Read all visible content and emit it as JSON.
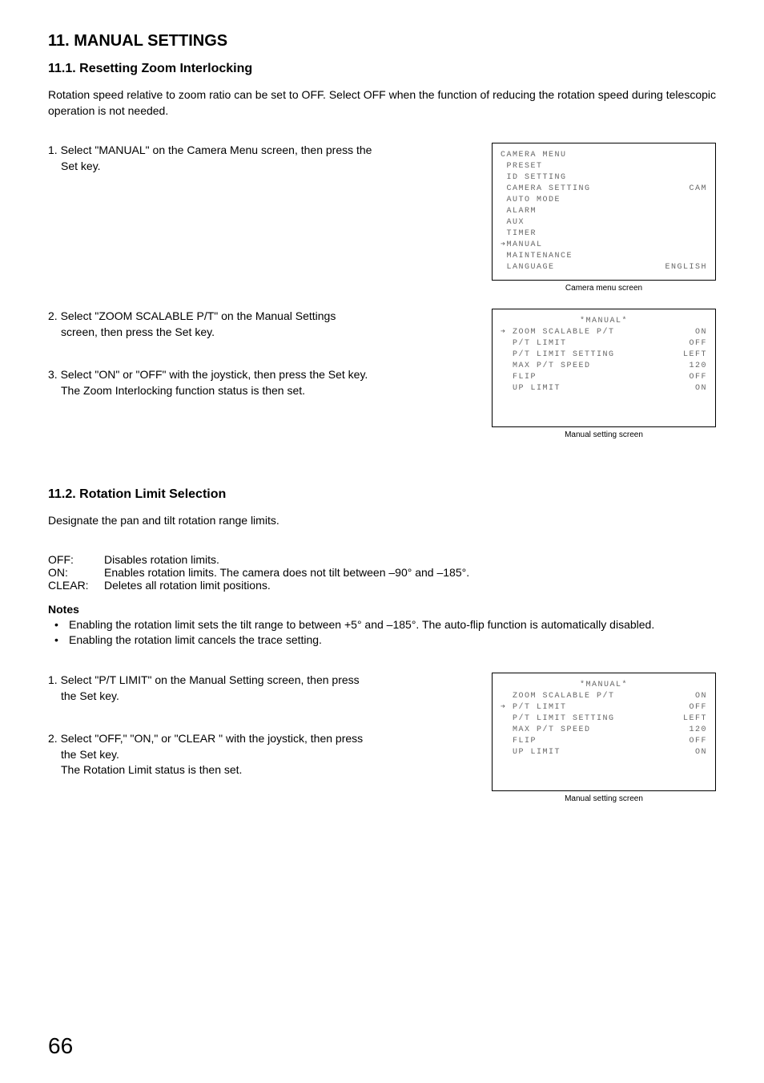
{
  "section": {
    "title": "11. MANUAL SETTINGS"
  },
  "sub1": {
    "title": "11.1. Resetting Zoom Interlocking",
    "intro": "Rotation speed relative to zoom ratio can be set to OFF. Select OFF when the function of reducing the rotation speed during telescopic operation is not needed.",
    "step1a": "1. Select \"MANUAL\" on the Camera Menu screen, then press the",
    "step1b": "Set key.",
    "step2a": "2. Select \"ZOOM SCALABLE P/T\" on the Manual Settings",
    "step2b": "screen, then press the Set key.",
    "step3a": "3. Select \"ON\" or \"OFF\" with the joystick, then press the Set key.",
    "step3b": "The Zoom Interlocking function status is then set."
  },
  "osd_camera_menu": {
    "title": "CAMERA MENU",
    "items": [
      {
        "label": " PRESET",
        "value": ""
      },
      {
        "label": " ID SETTING",
        "value": ""
      },
      {
        "label": " CAMERA SETTING",
        "value": "CAM"
      },
      {
        "label": " AUTO MODE",
        "value": ""
      },
      {
        "label": " ALARM",
        "value": ""
      },
      {
        "label": " AUX",
        "value": ""
      },
      {
        "label": " TIMER",
        "value": ""
      },
      {
        "label": "➔MANUAL",
        "value": ""
      },
      {
        "label": " MAINTENANCE",
        "value": ""
      },
      {
        "label": " LANGUAGE",
        "value": "ENGLISH"
      }
    ],
    "caption": "Camera menu screen"
  },
  "osd_manual_1": {
    "title": "*MANUAL*",
    "items": [
      {
        "label": "➔ ZOOM SCALABLE P/T",
        "value": "ON"
      },
      {
        "label": "  P/T LIMIT",
        "value": "OFF"
      },
      {
        "label": "  P/T LIMIT SETTING",
        "value": "LEFT"
      },
      {
        "label": "  MAX P/T SPEED",
        "value": "120"
      },
      {
        "label": "  FLIP",
        "value": "OFF"
      },
      {
        "label": "  UP LIMIT",
        "value": "ON"
      }
    ],
    "caption": "Manual setting screen"
  },
  "sub2": {
    "title": "11.2. Rotation Limit Selection",
    "intro": "Designate the pan and tilt rotation range limits.",
    "defs": [
      {
        "label": "OFF:",
        "text": "Disables rotation limits."
      },
      {
        "label": "ON:",
        "text": "Enables rotation limits. The camera does not tilt between –90° and –185°."
      },
      {
        "label": "CLEAR:",
        "text": "Deletes all rotation limit positions."
      }
    ],
    "notes_title": "Notes",
    "notes": [
      "Enabling the rotation limit sets the tilt range to between +5° and –185°. The auto-flip function is automatically disabled.",
      "Enabling the rotation limit cancels the trace setting."
    ],
    "step1a": "1. Select \"P/T LIMIT\" on the Manual Setting screen, then press",
    "step1b": "the Set key.",
    "step2a": "2. Select \"OFF,\" \"ON,\" or \"CLEAR \" with the joystick, then press",
    "step2b": "the Set key.",
    "step2c": "The Rotation Limit status is then set."
  },
  "osd_manual_2": {
    "title": "*MANUAL*",
    "items": [
      {
        "label": "  ZOOM SCALABLE P/T",
        "value": "ON"
      },
      {
        "label": "➔ P/T LIMIT",
        "value": "OFF"
      },
      {
        "label": "  P/T LIMIT SETTING",
        "value": "LEFT"
      },
      {
        "label": "  MAX P/T SPEED",
        "value": "120"
      },
      {
        "label": "  FLIP",
        "value": "OFF"
      },
      {
        "label": "  UP LIMIT",
        "value": "ON"
      }
    ],
    "caption": "Manual setting screen"
  },
  "page_number": "66"
}
